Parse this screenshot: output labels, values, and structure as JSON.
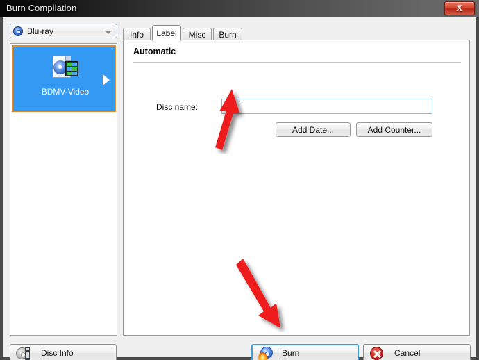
{
  "window": {
    "title": "Burn Compilation",
    "close_label": "X",
    "close_icon": "close-icon"
  },
  "media_select": {
    "icon": "disc-icon",
    "value": "Blu-ray",
    "chevron_icon": "chevron-down-icon"
  },
  "compilation_list": {
    "items": [
      {
        "label": "BDMV-Video",
        "icon": "bdmv-video-document-icon",
        "chevron_icon": "chevron-right-icon",
        "selected": true
      }
    ]
  },
  "tabs": [
    {
      "label": "Info",
      "active": false
    },
    {
      "label": "Label",
      "active": true
    },
    {
      "label": "Misc",
      "active": false
    },
    {
      "label": "Burn",
      "active": false
    }
  ],
  "label_tab": {
    "section_title": "Automatic",
    "disc_name": {
      "label": "Disc name:",
      "value": "BD",
      "placeholder": ""
    },
    "add_date_label": "Add Date...",
    "add_counter_label": "Add Counter..."
  },
  "bottom_bar": {
    "disc_info": {
      "label_prefix": "",
      "accel": "D",
      "label_suffix": "isc Info",
      "icon": "disc-info-icon"
    },
    "burn": {
      "label_prefix": "",
      "accel": "B",
      "label_suffix": "urn",
      "icon": "burn-disc-flame-icon",
      "focused": true
    },
    "cancel": {
      "label_prefix": "",
      "accel": "C",
      "label_suffix": "ancel",
      "icon": "cancel-icon"
    }
  },
  "annotations": {
    "arrows": [
      {
        "name": "arrow-to-disc-name-field",
        "direction": "up-right",
        "color": "#ee1c1c"
      },
      {
        "name": "arrow-to-burn-button",
        "direction": "down-right",
        "color": "#ee1c1c"
      }
    ]
  },
  "colors": {
    "selection_blue": "#3399f2",
    "selection_border_orange": "#e08a2a",
    "focus_blue": "#3ea0e0",
    "annotation_red": "#ee1c1c",
    "titlebar_dark": "#0a0a0a",
    "window_chrome": "#4a4a4a"
  }
}
